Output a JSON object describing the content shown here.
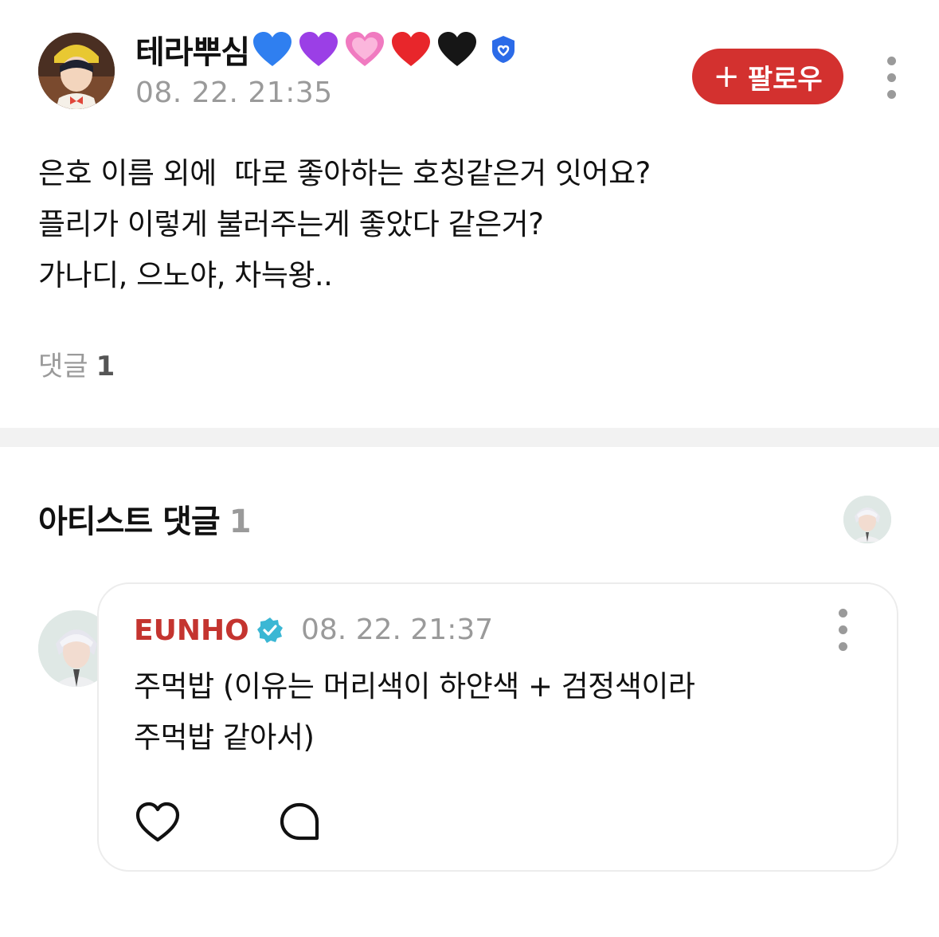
{
  "post": {
    "author": "테라뿌심",
    "author_emojis": [
      "blue-heart",
      "purple-heart",
      "pink-heart",
      "red-heart",
      "black-heart"
    ],
    "timestamp": "08. 22. 21:35",
    "follow_label": "팔로우",
    "follow_icon": "+",
    "body_lines": [
      "은호 이름 외에  따로 좋아하는 호칭같은거 잇어요?",
      "플리가 이렇게 불러주는게 좋았다 같은거?",
      "가나디, 으노야, 차늑왕.."
    ],
    "comments_label": "댓글",
    "comments_count": "1"
  },
  "artist_section": {
    "title": "아티스트 댓글",
    "count": "1"
  },
  "comment": {
    "author": "EUNHO",
    "timestamp": "08. 22. 21:37",
    "body_lines": [
      "주먹밥 (이유는 머리색이 하얀색 + 검정색이라",
      "주먹밥 같아서)"
    ]
  },
  "colors": {
    "accent_red": "#d3312f",
    "artist_name": "#c4342f",
    "verified_blue": "#2b6be8",
    "verified_teal": "#3bb7d4",
    "muted_text": "#9a9a9a"
  }
}
